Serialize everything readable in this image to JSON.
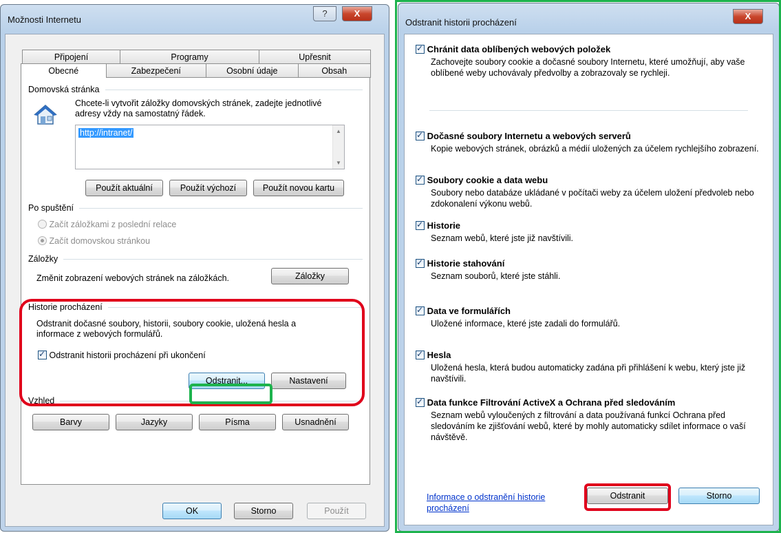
{
  "left": {
    "title": "Možnosti Internetu",
    "help_glyph": "?",
    "close_glyph": "X",
    "tabs_row1": [
      "Připojení",
      "Programy",
      "Upřesnit"
    ],
    "tabs_row2": [
      "Obecné",
      "Zabezpečení",
      "Osobní údaje",
      "Obsah"
    ],
    "homepage": {
      "label": "Domovská stránka",
      "desc": "Chcete-li vytvořit záložky domovských stránek, zadejte jednotlivé adresy vždy na samostatný řádek.",
      "url": "http://intranet/",
      "btn_current": "Použít aktuální",
      "btn_default": "Použít výchozí",
      "btn_new_tab": "Použít novou kartu"
    },
    "startup": {
      "label": "Po spuštění",
      "option1": "Začít záložkami z poslední relace",
      "option2": "Začít domovskou stránkou"
    },
    "tabs_section": {
      "label": "Záložky",
      "desc": "Změnit zobrazení webových stránek na záložkách.",
      "button": "Záložky"
    },
    "history": {
      "label": "Historie procházení",
      "desc": "Odstranit dočasné soubory, historii, soubory cookie, uložená hesla a informace z webových formulářů.",
      "checkbox": "Odstranit historii procházení při ukončení",
      "btn_delete": "Odstranit...",
      "btn_settings": "Nastavení"
    },
    "appearance": {
      "label": "Vzhled",
      "btn_colors": "Barvy",
      "btn_languages": "Jazyky",
      "btn_fonts": "Písma",
      "btn_accessibility": "Usnadnění"
    },
    "footer": {
      "ok": "OK",
      "cancel": "Storno",
      "apply": "Použít"
    }
  },
  "right": {
    "title": "Odstranit historii procházení",
    "close_glyph": "X",
    "items": [
      {
        "head": "Chránit data oblíbených webových položek",
        "desc": "Zachovejte soubory cookie a dočasné soubory Internetu, které umožňují, aby vaše oblíbené weby uchovávaly předvolby a zobrazovaly se rychleji.",
        "checked": true
      },
      {
        "head": "Dočasné soubory Internetu a webových serverů",
        "desc": "Kopie webových stránek, obrázků a médií uložených za účelem rychlejšího zobrazení.",
        "checked": true
      },
      {
        "head": "Soubory cookie a data webu",
        "desc": "Soubory nebo databáze ukládané v počítači weby za účelem uložení předvoleb nebo zdokonalení výkonu webů.",
        "checked": true
      },
      {
        "head": "Historie",
        "desc": "Seznam webů, které jste již navštívili.",
        "checked": true
      },
      {
        "head": "Historie stahování",
        "desc": "Seznam souborů, které jste stáhli.",
        "checked": true
      },
      {
        "head": "Data ve formulářích",
        "desc": "Uložené informace, které jste zadali do formulářů.",
        "checked": true
      },
      {
        "head": "Hesla",
        "desc": "Uložená hesla, která budou automaticky zadána při přihlášení k webu, který jste již navštívili.",
        "checked": true
      },
      {
        "head": "Data funkce Filtrování ActiveX a Ochrana před sledováním",
        "desc": "Seznam webů vyloučených z filtrování a data používaná funkcí Ochrana před sledováním ke zjišťování webů, které by mohly automaticky sdílet informace o vaší návštěvě.",
        "checked": true
      }
    ],
    "link": "Informace o odstranění historie procházení",
    "btn_delete": "Odstranit",
    "btn_cancel": "Storno"
  }
}
